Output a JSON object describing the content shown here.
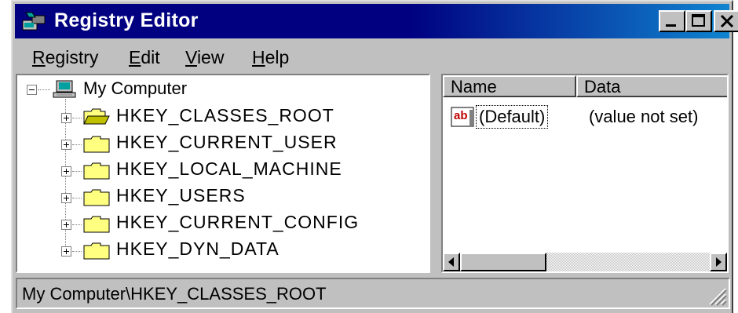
{
  "window": {
    "title": "Registry Editor",
    "controls": [
      "minimize-button",
      "maximize-button",
      "close-button"
    ]
  },
  "menu": [
    {
      "label": "Registry",
      "accel": "R",
      "rest": "egistry"
    },
    {
      "label": "Edit",
      "accel": "E",
      "rest": "dit"
    },
    {
      "label": "View",
      "accel": "V",
      "rest": "iew"
    },
    {
      "label": "Help",
      "accel": "H",
      "rest": "elp"
    }
  ],
  "tree": {
    "root": "My Computer",
    "keys": [
      {
        "label": "HKEY_CLASSES_ROOT",
        "selected": true
      },
      {
        "label": "HKEY_CURRENT_USER"
      },
      {
        "label": "HKEY_LOCAL_MACHINE"
      },
      {
        "label": "HKEY_USERS"
      },
      {
        "label": "HKEY_CURRENT_CONFIG"
      },
      {
        "label": "HKEY_DYN_DATA"
      }
    ]
  },
  "list": {
    "columns": [
      "Name",
      "Data"
    ],
    "rows": [
      {
        "name": "(Default)",
        "data": "(value not set)",
        "icon": "string-value-icon"
      }
    ]
  },
  "status": "My Computer\\HKEY_CLASSES_ROOT",
  "colors": {
    "titlebar": "#000080",
    "face": "#c0c0c0",
    "folder": "#ffff80"
  }
}
